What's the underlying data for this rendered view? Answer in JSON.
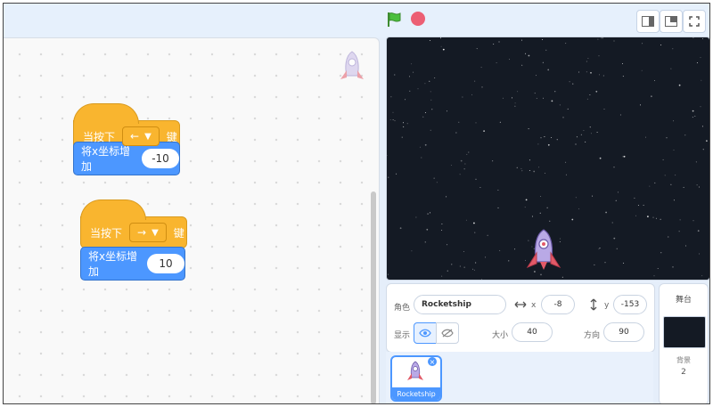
{
  "toolbar": {
    "flag_icon": "green-flag-icon",
    "stop_icon": "stop-icon",
    "modes": [
      "small-stage-icon",
      "large-stage-icon",
      "fullscreen-icon"
    ]
  },
  "scripts": [
    {
      "hat_label": "当按下",
      "key": "←",
      "suffix": "键",
      "action": "将x坐标增加",
      "value": "-10"
    },
    {
      "hat_label": "当按下",
      "key": "→",
      "suffix": "键",
      "action": "将x坐标增加",
      "value": "10"
    }
  ],
  "sprite_info": {
    "sprite_label": "角色",
    "sprite_name": "Rocketship",
    "x_label": "x",
    "x": "-8",
    "y_label": "y",
    "y": "-153",
    "show_label": "显示",
    "size_label": "大小",
    "size": "40",
    "direction_label": "方向",
    "direction": "90"
  },
  "sprite_list": [
    {
      "name": "Rocketship",
      "selected": true
    }
  ],
  "backdrop_panel": {
    "title": "舞台",
    "label": "背景",
    "count": "2"
  },
  "colors": {
    "events": "#f9b52f",
    "motion": "#4c97ff",
    "stage_bg": "#141a24",
    "accent": "#4c97ff"
  }
}
